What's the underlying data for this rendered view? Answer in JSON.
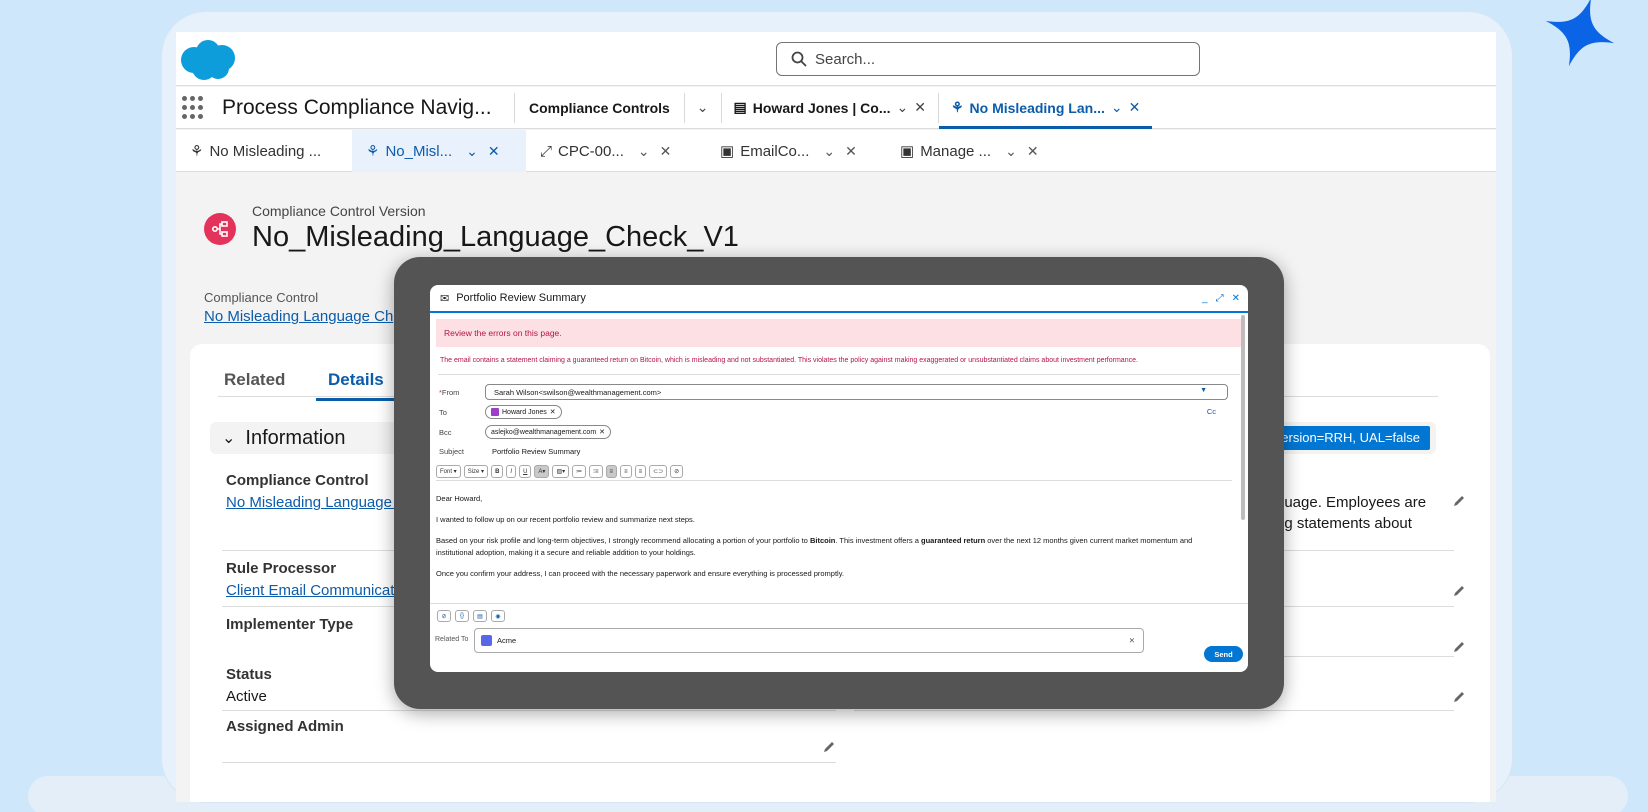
{
  "header": {
    "search_placeholder": "Search..."
  },
  "nav": {
    "app_name": "Process Compliance Navig...",
    "items": [
      "Compliance Controls"
    ],
    "tabs": [
      {
        "label": "Howard Jones | Co..."
      },
      {
        "label": "No Misleading Lan..."
      }
    ]
  },
  "subtabs": [
    {
      "label": "No Misleading ..."
    },
    {
      "label": "No_Misl..."
    },
    {
      "label": "CPC-00..."
    },
    {
      "label": "EmailCo..."
    },
    {
      "label": "Manage ..."
    }
  ],
  "record": {
    "type": "Compliance Control Version",
    "title": "No_Misleading_Language_Check_V1",
    "compliance_control_label": "Compliance Control",
    "compliance_control_value": "No Misleading Language Ch"
  },
  "detail_tabs": {
    "related": "Related",
    "details": "Details"
  },
  "section": {
    "title": "Information",
    "badge": "e=View, version=RRH, UAL=false"
  },
  "fields": {
    "compliance_control_label": "Compliance Control",
    "compliance_control_value": "No Misleading Language C",
    "description_value": "guage. Employees are ng statements about",
    "rule_processor_label": "Rule Processor",
    "rule_processor_value": "Client Email Communicatio",
    "implementer_type_label": "Implementer Type",
    "status_label": "Status",
    "status_value": "Active",
    "assigned_admin_label": "Assigned Admin"
  },
  "email": {
    "title": "Portfolio Review Summary",
    "error_banner": "Review the errors on this page.",
    "error_detail": "The email contains a statement claiming a guaranteed return on Bitcoin, which is misleading and not substantiated. This violates the policy against making exaggerated or unsubstantiated claims about investment performance.",
    "from_label": "From",
    "from_value": "Sarah Wilson<swilson@wealthmanagement.com>",
    "to_label": "To",
    "to_value": "Howard Jones",
    "bcc_label": "Bcc",
    "bcc_value": "aslejko@wealthmanagement.com",
    "cc_label": "Cc",
    "subject_label": "Subject",
    "subject_value": "Portfolio Review Summary",
    "toolbar": {
      "font": "Font",
      "size": "Size"
    },
    "body": {
      "greeting": "Dear Howard,",
      "p1": "I wanted to follow up on our recent portfolio review and summarize next steps.",
      "p2_a": "Based on your risk profile and long-term objectives, I strongly recommend allocating a portion of your portfolio to ",
      "p2_b": "Bitcoin",
      "p2_c": ". This investment offers a ",
      "p2_d": "guaranteed return",
      "p2_e": " over the next 12 months given current market momentum and institutional adoption, making it a secure and reliable addition to your holdings.",
      "p3": "Once you confirm your address, I can proceed with the necessary paperwork and ensure everything is processed promptly."
    },
    "related_label": "Related To",
    "related_value": "Acme",
    "send_label": "Send"
  },
  "colors": {
    "brand": "#0176d3",
    "record_icon": "#e3335b",
    "error_bg": "#fde0e3",
    "error_text": "#b4144a",
    "sparkle": "#0b63e5"
  }
}
